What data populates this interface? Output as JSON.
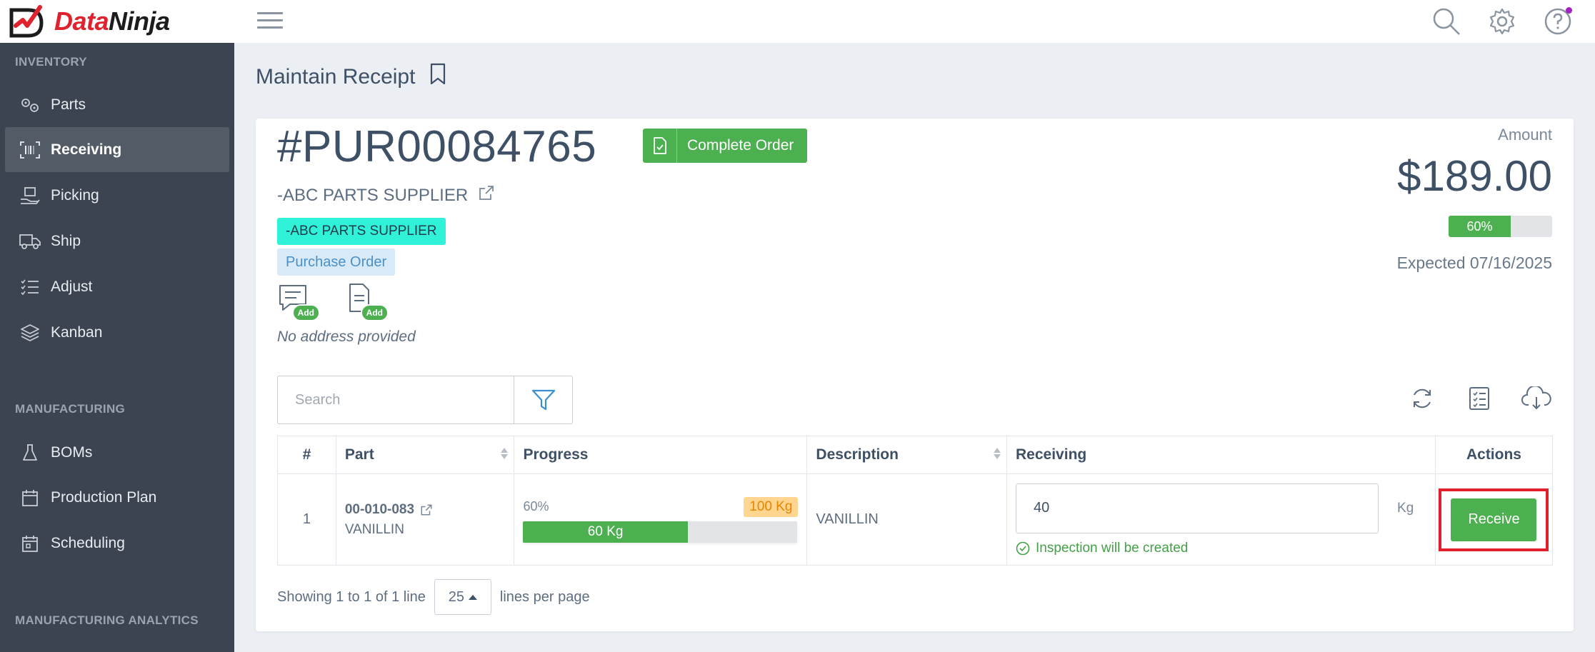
{
  "brand": {
    "name_part1": "Data",
    "name_part2": "Ninja"
  },
  "sidebar": {
    "sections": [
      {
        "title": "INVENTORY"
      },
      {
        "title": "MANUFACTURING"
      },
      {
        "title": "MANUFACTURING ANALYTICS"
      }
    ],
    "inventory_items": [
      {
        "label": "Parts",
        "icon": "gears-icon"
      },
      {
        "label": "Receiving",
        "icon": "barcode-icon",
        "active": true
      },
      {
        "label": "Picking",
        "icon": "box-hand-icon"
      },
      {
        "label": "Ship",
        "icon": "truck-icon"
      },
      {
        "label": "Adjust",
        "icon": "list-adjust-icon"
      },
      {
        "label": "Kanban",
        "icon": "layers-icon"
      }
    ],
    "manufacturing_items": [
      {
        "label": "BOMs",
        "icon": "flask-icon"
      },
      {
        "label": "Production Plan",
        "icon": "calendar-icon"
      },
      {
        "label": "Scheduling",
        "icon": "calendar-schedule-icon"
      }
    ]
  },
  "page": {
    "title": "Maintain Receipt"
  },
  "order": {
    "number": "#PUR00084765",
    "complete_label": "Complete Order",
    "supplier": "-ABC PARTS SUPPLIER",
    "supplier_badge": "-ABC PARTS SUPPLIER",
    "type_badge": "Purchase Order",
    "add_label": "Add",
    "no_address": "No address provided",
    "amount_label": "Amount",
    "amount_value": "$189.00",
    "progress_label": "60%",
    "progress_fraction": 0.6,
    "expected": "Expected 07/16/2025"
  },
  "toolbar": {
    "search_placeholder": "Search"
  },
  "table": {
    "headers": [
      "#",
      "Part",
      "Progress",
      "Description",
      "Receiving",
      "Actions"
    ],
    "rows": [
      {
        "index": "1",
        "part_number": "00-010-083",
        "part_name": "VANILLIN",
        "progress_pct": "60%",
        "progress_total": "100 Kg",
        "progress_received": "60 Kg",
        "progress_fraction": 0.6,
        "description": "VANILLIN",
        "receiving_value": "40",
        "unit": "Kg",
        "inspection_note": "Inspection will be created",
        "action_label": "Receive"
      }
    ]
  },
  "pager": {
    "showing": "Showing 1 to 1 of 1 line",
    "per_page": "25",
    "per_page_suffix": "lines per page"
  },
  "colors": {
    "accent_green": "#4caf50",
    "sidebar_bg": "#3b4450",
    "highlight_red": "#e0202a",
    "supplier_badge": "#2ff2d8"
  }
}
